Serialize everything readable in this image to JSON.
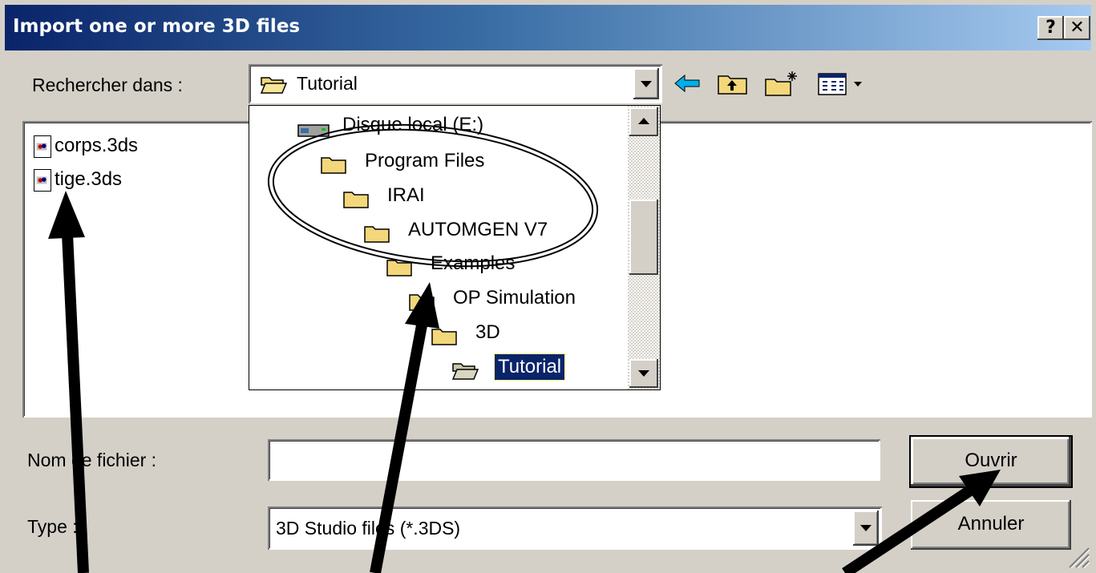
{
  "window": {
    "title": "Import one or more 3D files",
    "help_label": "?",
    "close_label": "✕"
  },
  "lookin": {
    "label": "Rechercher dans :",
    "value": "Tutorial"
  },
  "toolbar_icons": [
    "back-arrow-icon",
    "up-one-level-icon",
    "new-folder-icon",
    "view-menu-icon"
  ],
  "files": [
    {
      "name": "corps.3ds",
      "icon": "3ds-file-icon"
    },
    {
      "name": "tige.3ds",
      "icon": "3ds-file-icon"
    }
  ],
  "dropdown_items": [
    {
      "label": "Disque local (E:)",
      "icon": "drive-icon"
    },
    {
      "label": "Program Files",
      "icon": "folder-icon"
    },
    {
      "label": "IRAI",
      "icon": "folder-icon"
    },
    {
      "label": "AUTOMGEN V7",
      "icon": "folder-icon"
    },
    {
      "label": "Examples",
      "icon": "folder-icon"
    },
    {
      "label": "OP Simulation",
      "icon": "folder-icon"
    },
    {
      "label": "3D",
      "icon": "folder-icon"
    },
    {
      "label": "Tutorial",
      "icon": "open-folder-icon",
      "selected": true
    }
  ],
  "filename": {
    "label": "Nom de fichier :",
    "value": ""
  },
  "filetype": {
    "label": "Type :",
    "value": "3D Studio files (*.3DS)"
  },
  "buttons": {
    "open": "Ouvrir",
    "cancel": "Annuler"
  },
  "colors": {
    "title_start": "#0a246a",
    "title_end": "#a6caf0",
    "dialog_face": "#d4d0c8",
    "selection": "#0a246a",
    "annotation": "#000000"
  }
}
